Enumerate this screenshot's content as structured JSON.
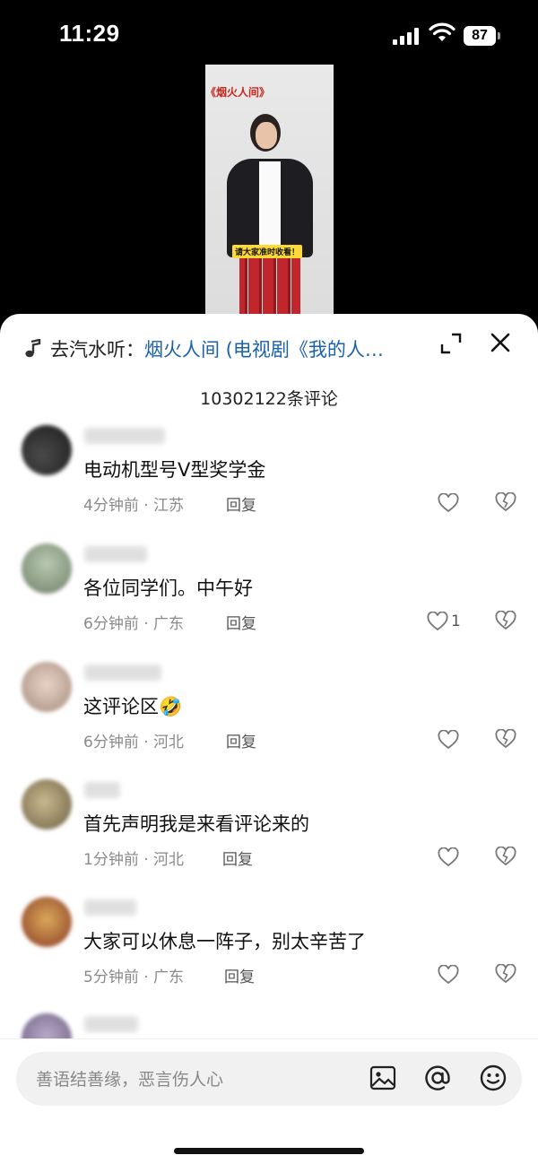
{
  "status_bar": {
    "time": "11:29",
    "battery": "87"
  },
  "video": {
    "title": "《烟火人间》",
    "caption": "请大家准时收看！"
  },
  "sheet": {
    "music_prefix": "去汽水听：",
    "music_title": "烟火人间 (电视剧《我的人…",
    "comment_count": "10302122条评论"
  },
  "comments": [
    {
      "text": "电动机型号V型奖学金",
      "meta": "4分钟前 · 江苏",
      "reply": "回复",
      "likes": ""
    },
    {
      "text": "各位同学们。中午好",
      "meta": "6分钟前 · 广东",
      "reply": "回复",
      "likes": "1"
    },
    {
      "text": "这评论区🤣",
      "meta": "6分钟前 · 河北",
      "reply": "回复",
      "likes": ""
    },
    {
      "text": "首先声明我是来看评论来的",
      "meta": "1分钟前 · 河北",
      "reply": "回复",
      "likes": ""
    },
    {
      "text": "大家可以休息一阵子，别太辛苦了",
      "meta": "5分钟前 · 广东",
      "reply": "回复",
      "likes": ""
    }
  ],
  "input": {
    "placeholder": "善语结善缘，恶言伤人心"
  },
  "icons": {
    "music": "music-note-icon",
    "expand": "expand-icon",
    "close": "close-icon",
    "like": "heart-icon",
    "dislike": "broken-heart-icon",
    "image": "image-icon",
    "mention": "at-icon",
    "emoji": "emoji-icon"
  }
}
